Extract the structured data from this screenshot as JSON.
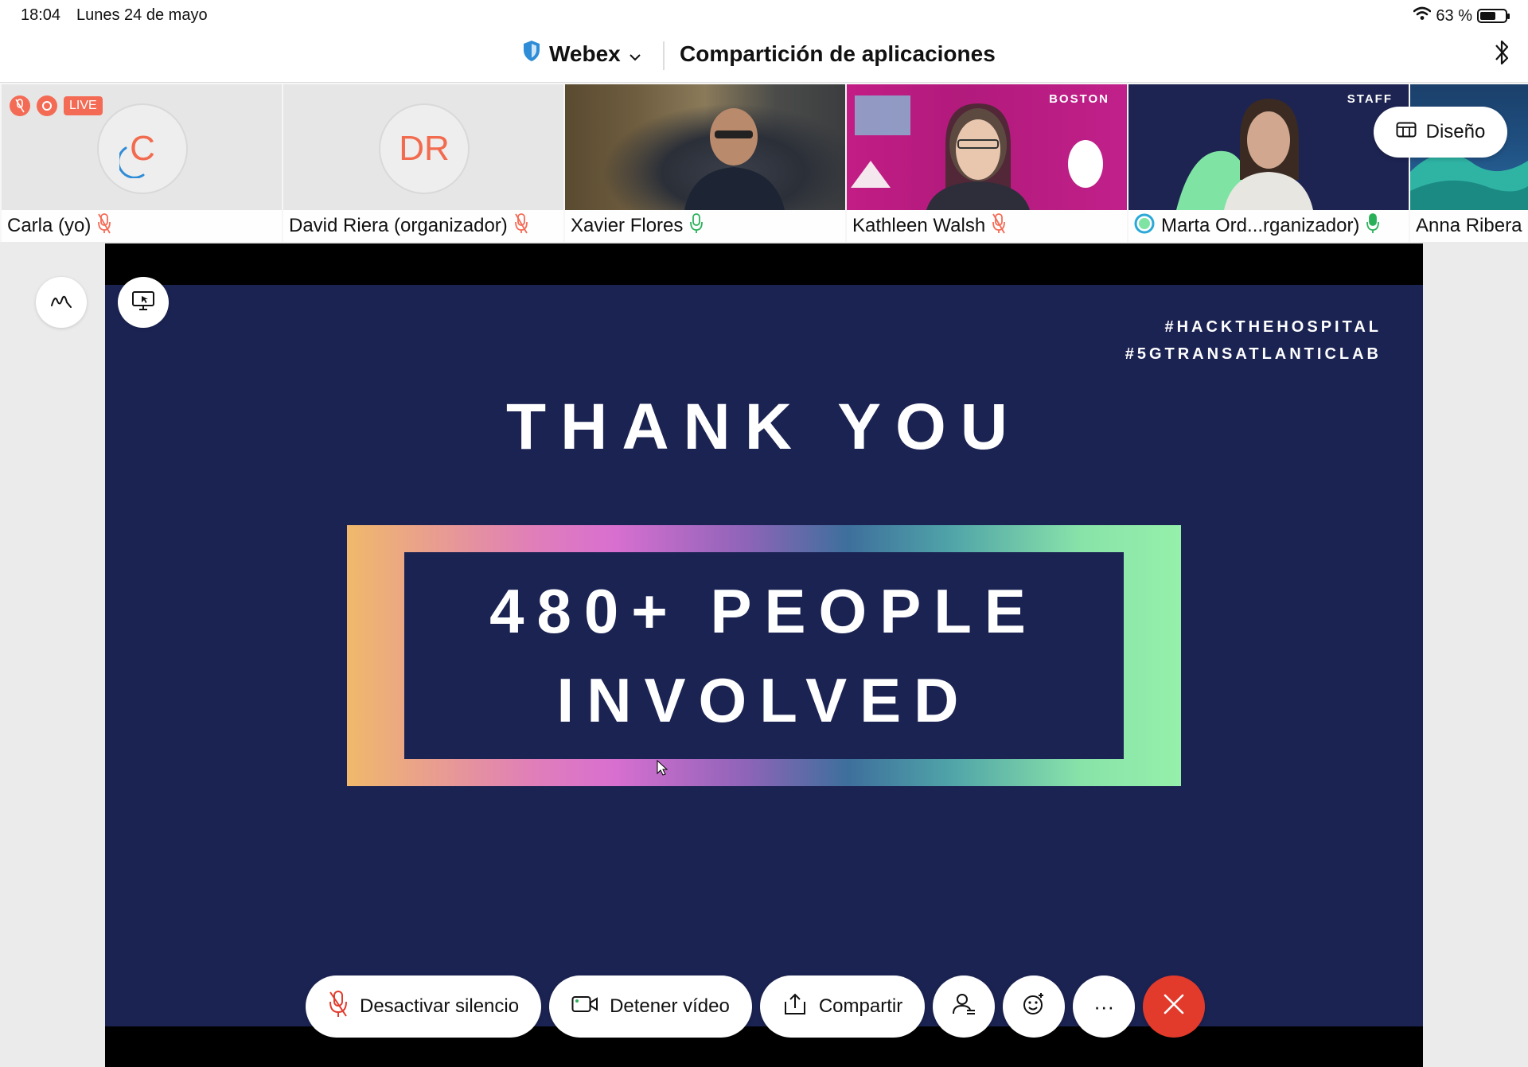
{
  "status_bar": {
    "time": "18:04",
    "date": "Lunes 24 de mayo",
    "battery": "63 %",
    "battery_level": 0.63
  },
  "header": {
    "app_name": "Webex",
    "title": "Compartición de aplicaciones"
  },
  "colors": {
    "accent_red": "#f46b55",
    "mic_on_green": "#2bb05a",
    "end_call": "#e23b2c",
    "slide_bg": "#1b2353"
  },
  "live_badge": "LIVE",
  "participants": [
    {
      "name": "Carla (yo)",
      "initials": "C",
      "mic": "muted"
    },
    {
      "name": "David Riera (organizador)",
      "initials": "DR",
      "mic": "muted"
    },
    {
      "name": "Xavier Flores",
      "mic": "on"
    },
    {
      "name": "Kathleen Walsh",
      "mic": "muted",
      "bg_label": "BOSTON"
    },
    {
      "name": "Marta Ord...rganizador)",
      "mic": "on",
      "bg_label": "STAFF"
    },
    {
      "name": "Anna Ribera"
    }
  ],
  "layout_button": "Diseño",
  "slide": {
    "hashtag_1": "#HACKTHEHOSPITAL",
    "hashtag_2": "#5GTRANSATLANTICLAB",
    "heading": "THANK YOU",
    "line_1": "480+ PEOPLE",
    "line_2": "INVOLVED"
  },
  "controls": {
    "unmute": "Desactivar silencio",
    "stop_video": "Detener vídeo",
    "share": "Compartir",
    "more": "···"
  }
}
